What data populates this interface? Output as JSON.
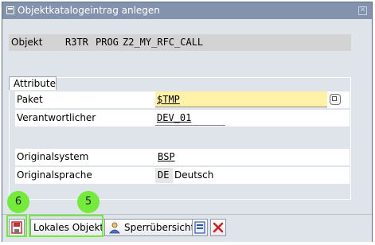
{
  "window": {
    "title": "Objektkatalogeintrag anlegen"
  },
  "header": {
    "objekt_label": "Objekt",
    "pgmid": "R3TR",
    "object_type": "PROG",
    "object_name": "Z2_MY_RFC_CALL"
  },
  "attributes": {
    "group_title": "Attribute",
    "paket_label": "Paket",
    "paket_value": "$TMP",
    "verantwortlicher_label": "Verantwortlicher",
    "verantwortlicher_value": "DEV_01",
    "originalsystem_label": "Originalsystem",
    "originalsystem_value": "BSP",
    "originalsprache_label": "Originalsprache",
    "originalsprache_code": "DE",
    "originalsprache_text": "Deutsch"
  },
  "toolbar": {
    "lokales_objekt_label": "Lokales Objekt",
    "sperruebersicht_label": "Sperrübersicht"
  },
  "callouts": {
    "six": "6",
    "five": "5"
  },
  "colors": {
    "title_bar": "#8393ad",
    "dialog_bg": "#dfe3ea",
    "required_field": "#fff2a6",
    "callout": "#74ea3a",
    "cancel_red": "#d42020"
  }
}
